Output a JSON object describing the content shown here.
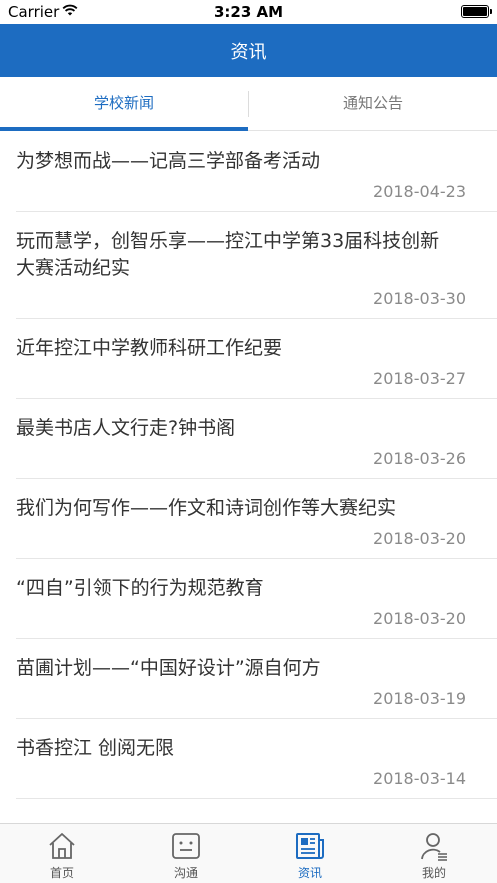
{
  "status_bar": {
    "carrier": "Carrier",
    "time": "3:23 AM"
  },
  "nav": {
    "title": "资讯"
  },
  "tabs": [
    {
      "label": "学校新闻",
      "active": true
    },
    {
      "label": "通知公告",
      "active": false
    }
  ],
  "news": [
    {
      "title": "为梦想而战——记高三学部备考活动",
      "date": "2018-04-23"
    },
    {
      "title": "玩而慧学，创智乐享——控江中学第33届科技创新大赛活动纪实",
      "date": "2018-03-30"
    },
    {
      "title": "近年控江中学教师科研工作纪要",
      "date": "2018-03-27"
    },
    {
      "title": "最美书店人文行走?钟书阁",
      "date": "2018-03-26"
    },
    {
      "title": "我们为何写作——作文和诗词创作等大赛纪实",
      "date": "2018-03-20"
    },
    {
      "title": "“四自”引领下的行为规范教育",
      "date": "2018-03-20"
    },
    {
      "title": "苗圃计划——“中国好设计”源自何方",
      "date": "2018-03-19"
    },
    {
      "title": "书香控江 创阅无限",
      "date": "2018-03-14"
    }
  ],
  "tab_bar": [
    {
      "label": "首页",
      "icon": "home-icon",
      "active": false
    },
    {
      "label": "沟通",
      "icon": "chat-icon",
      "active": false
    },
    {
      "label": "资讯",
      "icon": "news-icon",
      "active": true
    },
    {
      "label": "我的",
      "icon": "profile-icon",
      "active": false
    }
  ],
  "colors": {
    "accent": "#1d6cc1",
    "inactive": "#777777"
  }
}
